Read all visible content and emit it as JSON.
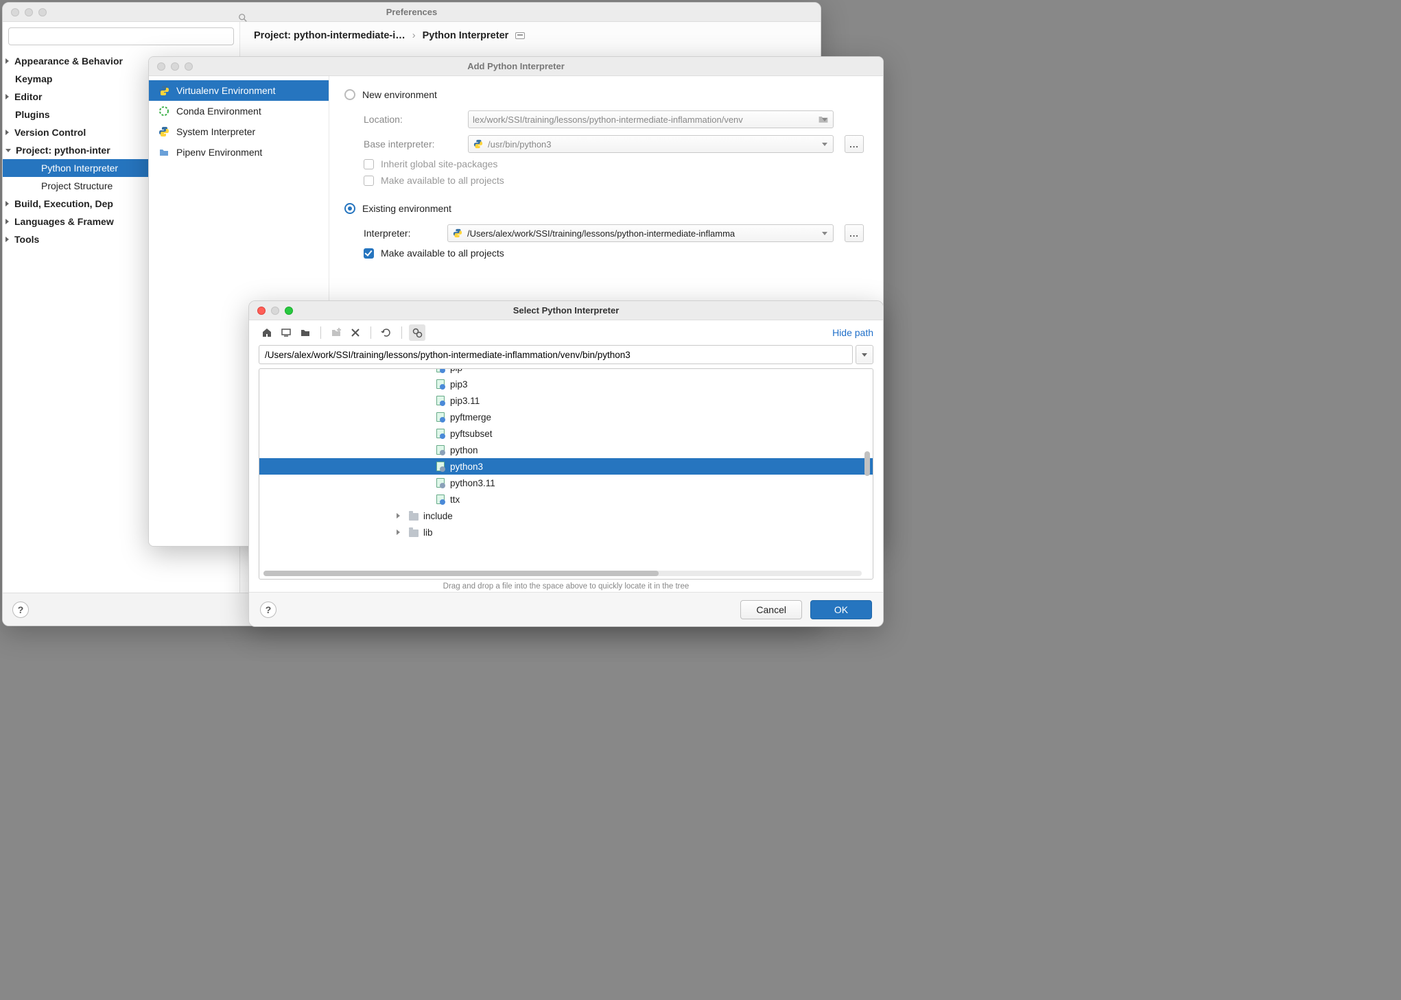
{
  "prefs": {
    "title": "Preferences",
    "breadcrumb": {
      "project": "Project: python-intermediate-i…",
      "page": "Python Interpreter"
    },
    "sidebar": [
      {
        "label": "Appearance & Behavior",
        "bold": true,
        "expand": true
      },
      {
        "label": "Keymap",
        "bold": true
      },
      {
        "label": "Editor",
        "bold": true,
        "expand": true
      },
      {
        "label": "Plugins",
        "bold": true
      },
      {
        "label": "Version Control",
        "bold": true,
        "expand": true
      },
      {
        "label": "Project: python-inter",
        "bold": true,
        "expanded": true
      },
      {
        "label": "Python Interpreter",
        "child": true,
        "selected": true
      },
      {
        "label": "Project Structure",
        "child": true
      },
      {
        "label": "Build, Execution, Dep",
        "bold": true,
        "expand": true
      },
      {
        "label": "Languages & Framew",
        "bold": true,
        "expand": true
      },
      {
        "label": "Tools",
        "bold": true,
        "expand": true
      }
    ]
  },
  "add": {
    "title": "Add Python Interpreter",
    "types": [
      {
        "label": "Virtualenv Environment",
        "icon": "python",
        "selected": true
      },
      {
        "label": "Conda Environment",
        "icon": "conda"
      },
      {
        "label": "System Interpreter",
        "icon": "python"
      },
      {
        "label": "Pipenv Environment",
        "icon": "pipenv"
      }
    ],
    "new_env": {
      "label": "New environment",
      "location_label": "Location:",
      "location": "lex/work/SSI/training/lessons/python-intermediate-inflammation/venv",
      "base_label": "Base interpreter:",
      "base": "/usr/bin/python3",
      "inherit": "Inherit global site-packages",
      "make_avail": "Make available to all projects"
    },
    "existing": {
      "label": "Existing environment",
      "interp_label": "Interpreter:",
      "interp": "/Users/alex/work/SSI/training/lessons/python-intermediate-inflamma",
      "make_avail": "Make available to all projects"
    }
  },
  "select": {
    "title": "Select Python Interpreter",
    "hide_path": "Hide path",
    "path": "/Users/alex/work/SSI/training/lessons/python-intermediate-inflammation/venv/bin/python3",
    "files": [
      {
        "name": "pip",
        "type": "py",
        "partial": true
      },
      {
        "name": "pip3",
        "type": "py"
      },
      {
        "name": "pip3.11",
        "type": "py"
      },
      {
        "name": "pyftmerge",
        "type": "py"
      },
      {
        "name": "pyftsubset",
        "type": "py"
      },
      {
        "name": "python",
        "type": "link"
      },
      {
        "name": "python3",
        "type": "link",
        "selected": true
      },
      {
        "name": "python3.11",
        "type": "link"
      },
      {
        "name": "ttx",
        "type": "py"
      }
    ],
    "folders": [
      {
        "name": "include"
      },
      {
        "name": "lib"
      }
    ],
    "hint": "Drag and drop a file into the space above to quickly locate it in the tree",
    "cancel": "Cancel",
    "ok": "OK"
  }
}
